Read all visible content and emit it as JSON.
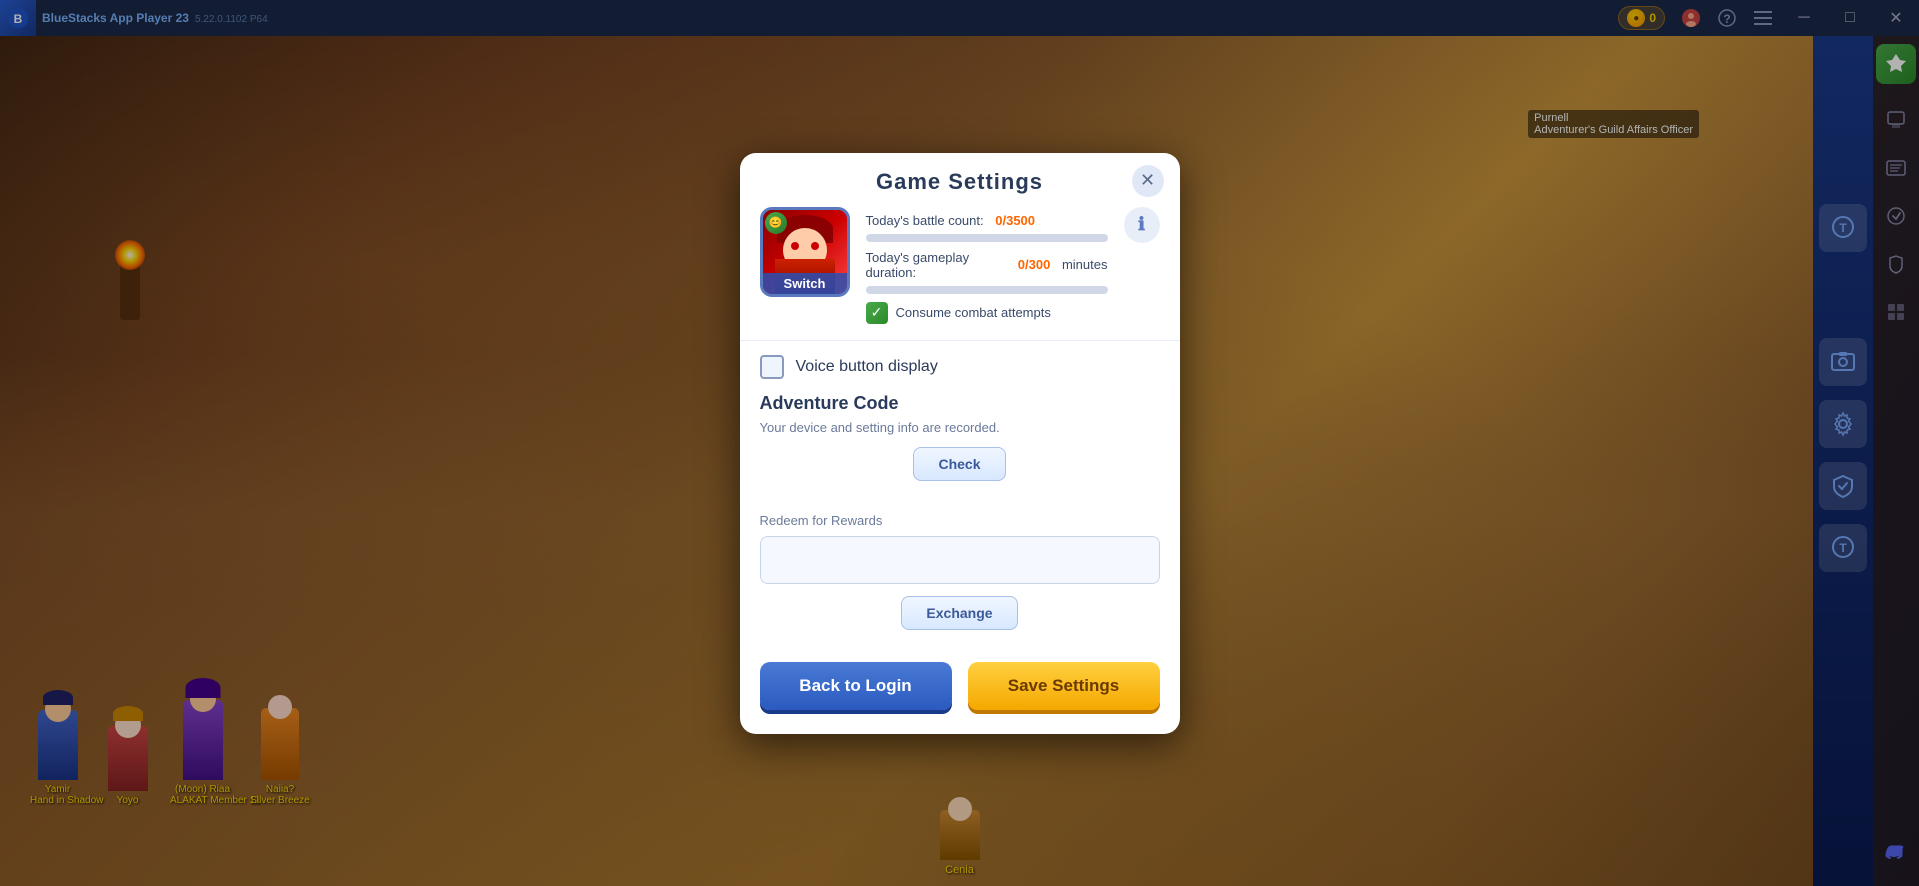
{
  "titlebar": {
    "app_name": "BlueStacks App Player 23",
    "version": "5.22.0.1102 P64",
    "coin_count": "0",
    "nav_back": "←",
    "nav_home": "⌂",
    "nav_copy": "⧉",
    "btn_minimize": "─",
    "btn_restore": "□",
    "btn_close": "✕"
  },
  "sidebar": {
    "icons": [
      "⊕",
      "☰",
      "⚙",
      "✉",
      "🔒",
      "⤢"
    ]
  },
  "right_panel": {
    "icons": [
      "🖼",
      "⚙",
      "🛡",
      "💬"
    ]
  },
  "modal": {
    "title": "Game Settings",
    "close_label": "✕",
    "avatar_label": "Switch",
    "battle_count_label": "Today's battle count:",
    "battle_count_value": "0/3500",
    "gameplay_duration_label": "Today's gameplay duration:",
    "gameplay_duration_value": "0/300",
    "gameplay_duration_unit": "minutes",
    "consume_combat_label": "Consume combat attempts",
    "voice_section": {
      "label": "Voice button display"
    },
    "adventure_code": {
      "title": "Adventure Code",
      "description": "Your device and setting info are recorded.",
      "check_btn": "Check"
    },
    "redeem": {
      "label": "Redeem for Rewards",
      "placeholder": "",
      "exchange_btn": "Exchange"
    },
    "footer": {
      "back_to_login": "Back to Login",
      "save_settings": "Save Settings"
    }
  },
  "game_ui": {
    "npc_name": "Purnell",
    "npc_title": "Adventurer's Guild Affairs Officer",
    "char1_name": "Yamir\nHand in Shadow",
    "char2_name": "Yoyo",
    "char3_name": "(Moon) Riaa\nALAKAT Member 11",
    "char4_name": "Naiia?\nSilver Breeze",
    "char5_name": "Cenia"
  }
}
